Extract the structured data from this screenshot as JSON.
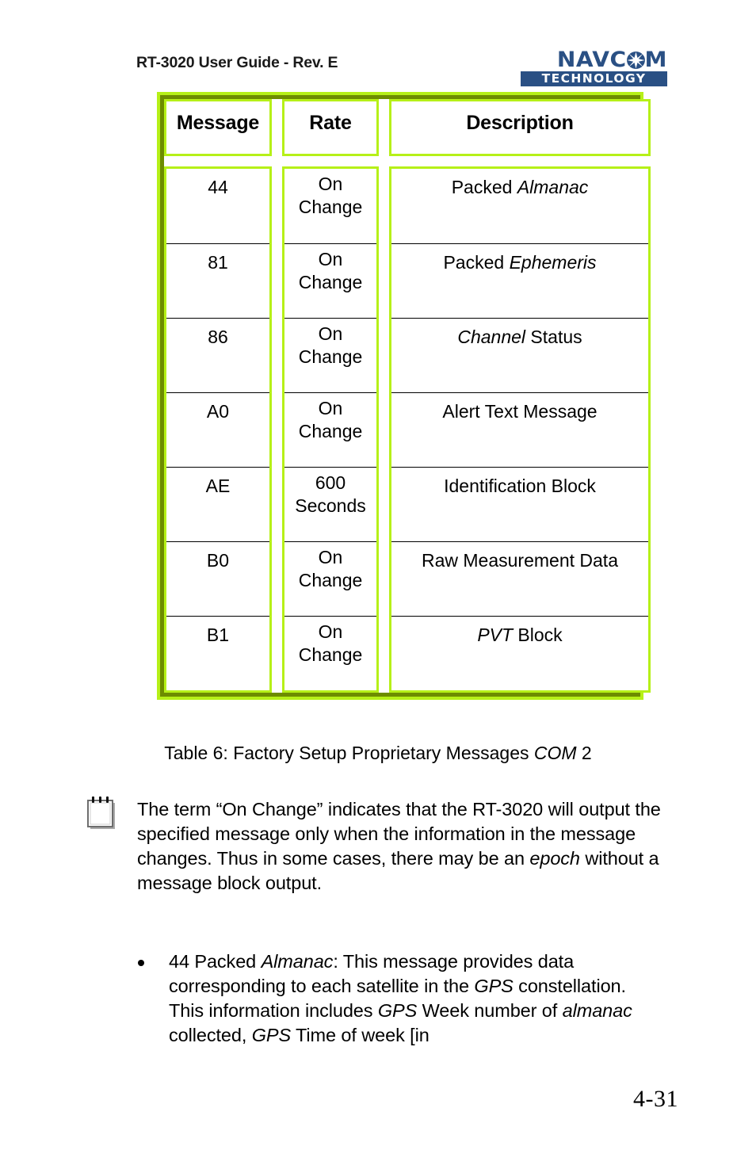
{
  "header": {
    "title": "RT-3020 User Guide - Rev. E",
    "logo": {
      "name_part1": "NAVC",
      "name_part2": "M",
      "star_icon": "star-burst-icon",
      "tagline": "TECHNOLOGY",
      "color": "#2a5084"
    }
  },
  "table": {
    "border_outer_color": "#b6f018",
    "border_inner_color": "#6d8c00",
    "columns": [
      "Message",
      "Rate",
      "Description"
    ],
    "rows": [
      {
        "message": "44",
        "rate_line1": "On",
        "rate_line2": "Change",
        "desc_plain": "Packed ",
        "desc_italic": "Almanac",
        "desc_tail": ""
      },
      {
        "message": "81",
        "rate_line1": "On",
        "rate_line2": "Change",
        "desc_plain": "Packed ",
        "desc_italic": "Ephemeris",
        "desc_tail": ""
      },
      {
        "message": "86",
        "rate_line1": "On",
        "rate_line2": "Change",
        "desc_plain": "",
        "desc_italic": "Channel",
        "desc_tail": " Status"
      },
      {
        "message": "A0",
        "rate_line1": "On",
        "rate_line2": "Change",
        "desc_plain": "Alert Text Message",
        "desc_italic": "",
        "desc_tail": ""
      },
      {
        "message": "AE",
        "rate_line1": "600",
        "rate_line2": "Seconds",
        "desc_plain": "Identification Block",
        "desc_italic": "",
        "desc_tail": ""
      },
      {
        "message": "B0",
        "rate_line1": "On",
        "rate_line2": "Change",
        "desc_plain": "Raw Measurement Data",
        "desc_italic": "",
        "desc_tail": ""
      },
      {
        "message": "B1",
        "rate_line1": "On",
        "rate_line2": "Change",
        "desc_plain": "",
        "desc_italic": "PVT",
        "desc_tail": " Block"
      }
    ]
  },
  "caption": {
    "prefix": "Table 6: Factory Setup Proprietary Messages ",
    "italic": "COM",
    "suffix": " 2"
  },
  "note": {
    "icon": "notepad-icon",
    "part1": "The term “On Change” indicates that the RT-3020 will output the specified message only when the information in the message changes. Thus in some cases, there may be an ",
    "italic1": "epoch",
    "part2": " without a message block output."
  },
  "bullets": [
    {
      "seg1": "44 Packed ",
      "ital1": "Almanac",
      "seg2": ": This message provides data corresponding to each satellite in the ",
      "ital2": "GPS",
      "seg3": " constellation. This information includes ",
      "ital3": "GPS",
      "seg4": " Week number of ",
      "ital4": "almanac",
      "seg5": " collected, ",
      "ital5": "GPS",
      "seg6": " Time of week [in"
    }
  ],
  "footer": {
    "page_number": "4-31"
  }
}
